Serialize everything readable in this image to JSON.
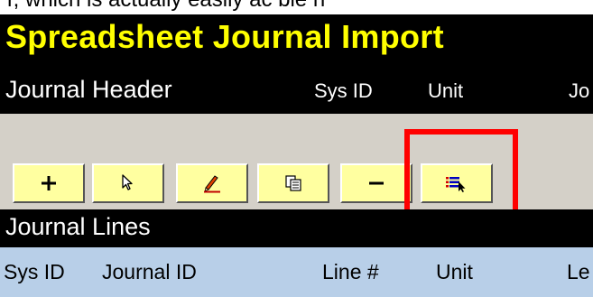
{
  "app": {
    "title": "Spreadsheet Journal Import"
  },
  "top_strip": {
    "partial_text": "r, which is actually easily ac      ble n"
  },
  "journal_header": {
    "label": "Journal Header",
    "columns": [
      "Sys ID",
      "Unit",
      "Jo"
    ]
  },
  "toolbar": {
    "buttons": [
      {
        "name": "add-button",
        "icon": "plus-icon",
        "label": "+"
      },
      {
        "name": "select-button",
        "icon": "pointer-icon",
        "label": ""
      },
      {
        "name": "edit-button",
        "icon": "edit-pencil-icon",
        "label": ""
      },
      {
        "name": "copy-button",
        "icon": "copy-icon",
        "label": ""
      },
      {
        "name": "delete-button",
        "icon": "minus-icon",
        "label": "−"
      },
      {
        "name": "list-select-button",
        "icon": "list-pointer-icon",
        "label": ""
      }
    ]
  },
  "journal_lines": {
    "label": "Journal Lines",
    "columns": [
      "Sys ID",
      "Journal ID",
      "Line #",
      "Unit",
      "Le"
    ]
  },
  "colors": {
    "title_yellow": "#ffff00",
    "button_yellow": "#ffffa0",
    "column_header_blue": "#b8cfe8",
    "highlight_red": "#ff0000"
  }
}
